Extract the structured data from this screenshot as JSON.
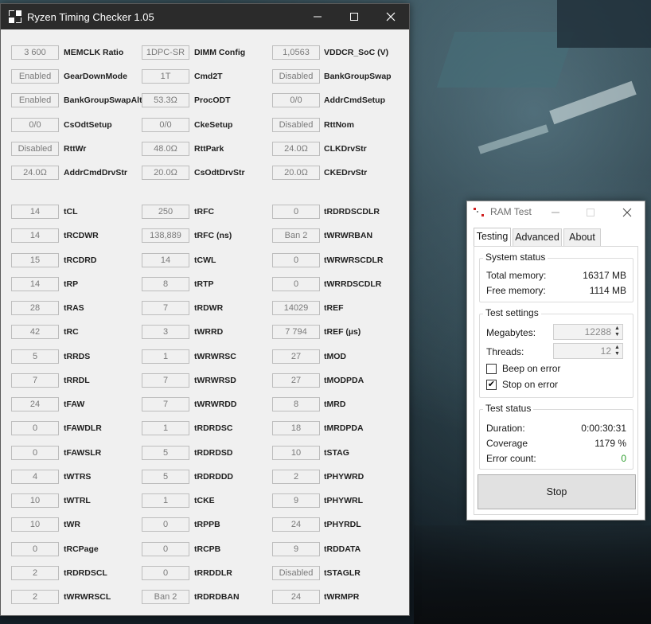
{
  "rtc": {
    "title": "Ryzen Timing Checker 1.05",
    "rows": [
      [
        {
          "v": "3 600",
          "l": "MEMCLK Ratio"
        },
        {
          "v": "1DPC-SR",
          "l": "DIMM Config"
        },
        {
          "v": "1,0563",
          "l": "VDDCR_SoC (V)"
        }
      ],
      [
        {
          "v": "Enabled",
          "l": "GearDownMode"
        },
        {
          "v": "1T",
          "l": "Cmd2T"
        },
        {
          "v": "Disabled",
          "l": "BankGroupSwap"
        }
      ],
      [
        {
          "v": "Enabled",
          "l": "BankGroupSwapAlt"
        },
        {
          "v": "53.3Ω",
          "l": "ProcODT"
        },
        {
          "v": "0/0",
          "l": "AddrCmdSetup"
        }
      ],
      [
        {
          "v": "0/0",
          "l": "CsOdtSetup"
        },
        {
          "v": "0/0",
          "l": "CkeSetup"
        },
        {
          "v": "Disabled",
          "l": "RttNom"
        }
      ],
      [
        {
          "v": "Disabled",
          "l": "RttWr"
        },
        {
          "v": "48.0Ω",
          "l": "RttPark"
        },
        {
          "v": "24.0Ω",
          "l": "CLKDrvStr"
        }
      ],
      [
        {
          "v": "24.0Ω",
          "l": "AddrCmdDrvStr"
        },
        {
          "v": "20.0Ω",
          "l": "CsOdtDrvStr"
        },
        {
          "v": "20.0Ω",
          "l": "CKEDrvStr"
        }
      ],
      [
        {
          "v": "14",
          "l": "tCL"
        },
        {
          "v": "250",
          "l": "tRFC"
        },
        {
          "v": "0",
          "l": "tRDRDSCDLR"
        }
      ],
      [
        {
          "v": "14",
          "l": "tRCDWR"
        },
        {
          "v": "138,889",
          "l": "tRFC (ns)"
        },
        {
          "v": "Ban 2",
          "l": "tWRWRBAN"
        }
      ],
      [
        {
          "v": "15",
          "l": "tRCDRD"
        },
        {
          "v": "14",
          "l": "tCWL"
        },
        {
          "v": "0",
          "l": "tWRWRSCDLR"
        }
      ],
      [
        {
          "v": "14",
          "l": "tRP"
        },
        {
          "v": "8",
          "l": "tRTP"
        },
        {
          "v": "0",
          "l": "tWRRDSCDLR"
        }
      ],
      [
        {
          "v": "28",
          "l": "tRAS"
        },
        {
          "v": "7",
          "l": "tRDWR"
        },
        {
          "v": "14029",
          "l": "tREF"
        }
      ],
      [
        {
          "v": "42",
          "l": "tRC"
        },
        {
          "v": "3",
          "l": "tWRRD"
        },
        {
          "v": "7 794",
          "l": "tREF (µs)"
        }
      ],
      [
        {
          "v": "5",
          "l": "tRRDS"
        },
        {
          "v": "1",
          "l": "tWRWRSC"
        },
        {
          "v": "27",
          "l": "tMOD"
        }
      ],
      [
        {
          "v": "7",
          "l": "tRRDL"
        },
        {
          "v": "7",
          "l": "tWRWRSD"
        },
        {
          "v": "27",
          "l": "tMODPDA"
        }
      ],
      [
        {
          "v": "24",
          "l": "tFAW"
        },
        {
          "v": "7",
          "l": "tWRWRDD"
        },
        {
          "v": "8",
          "l": "tMRD"
        }
      ],
      [
        {
          "v": "0",
          "l": "tFAWDLR"
        },
        {
          "v": "1",
          "l": "tRDRDSC"
        },
        {
          "v": "18",
          "l": "tMRDPDA"
        }
      ],
      [
        {
          "v": "0",
          "l": "tFAWSLR"
        },
        {
          "v": "5",
          "l": "tRDRDSD"
        },
        {
          "v": "10",
          "l": "tSTAG"
        }
      ],
      [
        {
          "v": "4",
          "l": "tWTRS"
        },
        {
          "v": "5",
          "l": "tRDRDDD"
        },
        {
          "v": "2",
          "l": "tPHYWRD"
        }
      ],
      [
        {
          "v": "10",
          "l": "tWTRL"
        },
        {
          "v": "1",
          "l": "tCKE"
        },
        {
          "v": "9",
          "l": "tPHYWRL"
        }
      ],
      [
        {
          "v": "10",
          "l": "tWR"
        },
        {
          "v": "0",
          "l": "tRPPB"
        },
        {
          "v": "24",
          "l": "tPHYRDL"
        }
      ],
      [
        {
          "v": "0",
          "l": "tRCPage"
        },
        {
          "v": "0",
          "l": "tRCPB"
        },
        {
          "v": "9",
          "l": "tRDDATA"
        }
      ],
      [
        {
          "v": "2",
          "l": "tRDRDSCL"
        },
        {
          "v": "0",
          "l": "tRRDDLR"
        },
        {
          "v": "Disabled",
          "l": "tSTAGLR"
        }
      ],
      [
        {
          "v": "2",
          "l": "tWRWRSCL"
        },
        {
          "v": "Ban 2",
          "l": "tRDRDBAN"
        },
        {
          "v": "24",
          "l": "tWRMPR"
        }
      ]
    ]
  },
  "ramtest": {
    "title": "RAM Test",
    "tabs": [
      "Testing",
      "Advanced",
      "About"
    ],
    "system_status": {
      "title": "System status",
      "total_label": "Total memory:",
      "total_value": "16317 MB",
      "free_label": "Free memory:",
      "free_value": "1114 MB"
    },
    "test_settings": {
      "title": "Test settings",
      "megabytes_label": "Megabytes:",
      "megabytes_value": "12288",
      "threads_label": "Threads:",
      "threads_value": "12",
      "beep_label": "Beep on error",
      "beep_checked": false,
      "stop_label": "Stop on error",
      "stop_checked": true
    },
    "test_status": {
      "title": "Test status",
      "duration_label": "Duration:",
      "duration_value": "0:00:30:31",
      "coverage_label": "Coverage",
      "coverage_value": "1179 %",
      "errors_label": "Error count:",
      "errors_value": "0",
      "errors_color": "#2e9e2e"
    },
    "stop_button": "Stop"
  }
}
